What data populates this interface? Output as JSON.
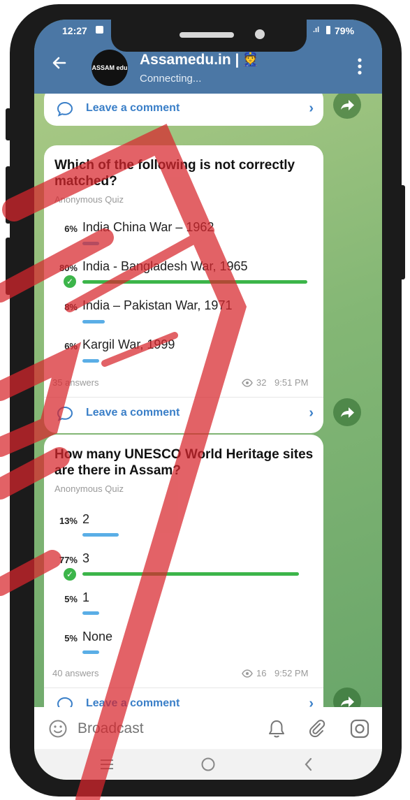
{
  "status": {
    "time": "12:27",
    "battery": "79%"
  },
  "header": {
    "channel_name": "Assamedu.in |",
    "status": "Connecting...",
    "avatar_text": "ASSAM edu"
  },
  "top_comment": {
    "label": "Leave a comment"
  },
  "quiz1": {
    "question_line1": "Which of the following is not correctly",
    "question_line2": "matched?",
    "type": "Anonymous Quiz",
    "options": [
      {
        "pct": "6%",
        "text": "India China War – 1962",
        "fraction": 0.06,
        "correct": false
      },
      {
        "pct": "80%",
        "text": "India - Bangladesh War, 1965",
        "fraction": 0.8,
        "correct": true
      },
      {
        "pct": "8%",
        "text": "India – Pakistan War, 1971",
        "fraction": 0.08,
        "correct": false
      },
      {
        "pct": "6%",
        "text": "Kargil War, 1999",
        "fraction": 0.06,
        "correct": false
      }
    ],
    "answers": "35 answers",
    "views": "32",
    "time": "9:51 PM",
    "comment_label": "Leave a comment"
  },
  "quiz2": {
    "question_line1": "How many UNESCO World Heritage sites",
    "question_line2": "are there in Assam?",
    "type": "Anonymous Quiz",
    "options": [
      {
        "pct": "13%",
        "text": "2",
        "fraction": 0.13,
        "correct": false
      },
      {
        "pct": "77%",
        "text": "3",
        "fraction": 0.77,
        "correct": true
      },
      {
        "pct": "5%",
        "text": "1",
        "fraction": 0.05,
        "correct": false
      },
      {
        "pct": "5%",
        "text": "None",
        "fraction": 0.05,
        "correct": false
      }
    ],
    "answers": "40 answers",
    "views": "16",
    "time": "9:52 PM",
    "comment_label": "Leave a comment"
  },
  "input": {
    "placeholder": "Broadcast"
  },
  "colors": {
    "header": "#4b77a5",
    "link": "#3a7fc8",
    "correct_bar": "#3cb54a",
    "bar": "#5aaee6",
    "stamp": "#d8262c"
  },
  "icons": [
    "back-arrow-icon",
    "more-vert-icon",
    "comment-icon",
    "chevron-right-icon",
    "share-icon",
    "emoji-icon",
    "bell-icon",
    "attach-icon",
    "instagram-icon",
    "eye-icon",
    "check-icon",
    "menu-nav-icon",
    "home-nav-icon",
    "back-nav-icon"
  ]
}
